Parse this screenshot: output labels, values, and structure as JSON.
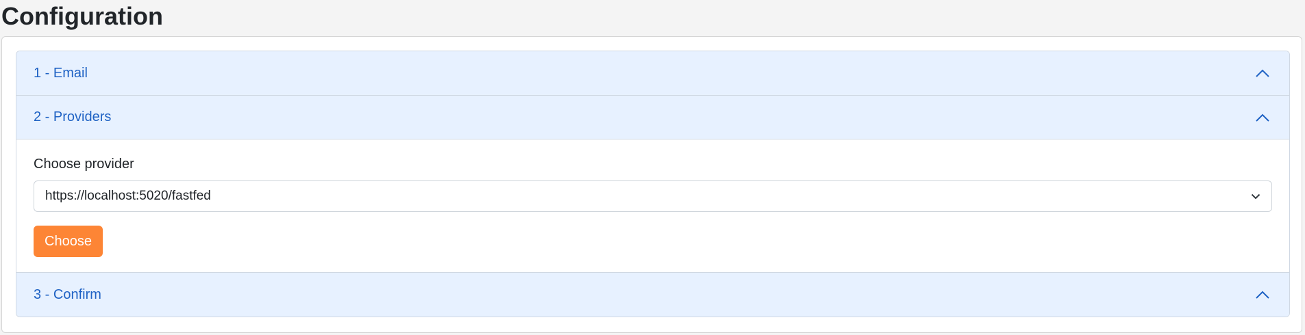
{
  "page": {
    "title": "Configuration"
  },
  "accordion": {
    "items": [
      {
        "label": "1 - Email",
        "expanded": false
      },
      {
        "label": "2 - Providers",
        "expanded": true
      },
      {
        "label": "3 - Confirm",
        "expanded": false
      }
    ]
  },
  "providers": {
    "field_label": "Choose provider",
    "selected_value": "https://localhost:5020/fastfed",
    "button_label": "Choose"
  },
  "icons": {
    "accordion_toggle": "chevron-up-icon",
    "select_caret": "chevron-down-icon"
  },
  "colors": {
    "header_bg": "#e7f1ff",
    "header_text": "#1f62c4",
    "button_bg": "#fd8535"
  }
}
